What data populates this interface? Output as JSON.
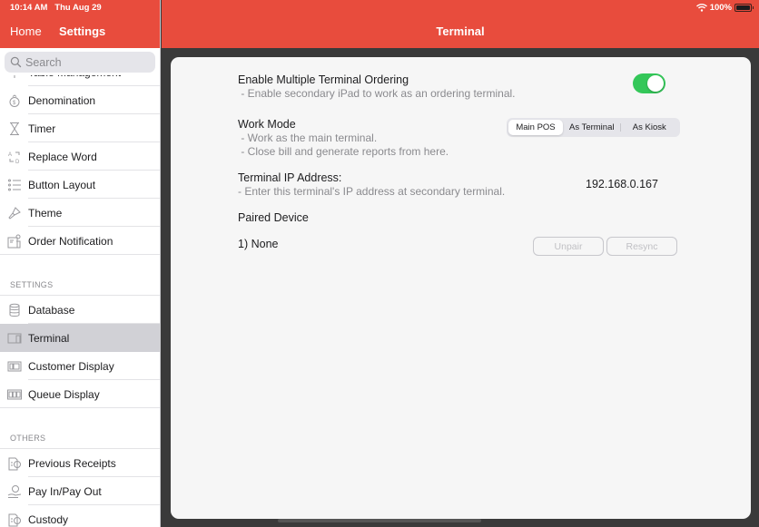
{
  "status_bar": {
    "time": "10:14 AM",
    "date": "Thu Aug 29",
    "battery_text": "100%",
    "wifi_icon": "wifi-icon",
    "battery_icon": "battery-icon"
  },
  "sidebar": {
    "nav": {
      "home_label": "Home",
      "title": "Settings"
    },
    "search": {
      "placeholder": "Search",
      "value": ""
    },
    "partial_item": {
      "label": "Table Management",
      "icon": "table-icon"
    },
    "groups": [
      {
        "header": "",
        "items": [
          {
            "label": "Denomination",
            "icon": "money-bag-icon"
          },
          {
            "label": "Timer",
            "icon": "hourglass-icon"
          },
          {
            "label": "Replace Word",
            "icon": "replace-icon"
          },
          {
            "label": "Button Layout",
            "icon": "list-icon"
          },
          {
            "label": "Theme",
            "icon": "brush-icon"
          },
          {
            "label": "Order Notification",
            "icon": "notification-icon"
          }
        ]
      },
      {
        "header": "SETTINGS",
        "items": [
          {
            "label": "Database",
            "icon": "database-icon"
          },
          {
            "label": "Terminal",
            "icon": "terminal-icon",
            "selected": true
          },
          {
            "label": "Customer Display",
            "icon": "customer-display-icon"
          },
          {
            "label": "Queue Display",
            "icon": "queue-display-icon"
          }
        ]
      },
      {
        "header": "OTHERS",
        "items": [
          {
            "label": "Previous Receipts",
            "icon": "receipt-icon"
          },
          {
            "label": "Pay In/Pay Out",
            "icon": "pay-hand-icon"
          },
          {
            "label": "Custody",
            "icon": "receipt-icon"
          }
        ]
      }
    ]
  },
  "main": {
    "title": "Terminal",
    "multi_terminal": {
      "title": "Enable Multiple Terminal Ordering",
      "desc": " - Enable secondary iPad to work as an ordering terminal.",
      "enabled": true
    },
    "work_mode": {
      "title": "Work Mode",
      "desc_lines": [
        " - Work as the main terminal.",
        " - Close bill and generate reports from here."
      ],
      "options": [
        "Main POS",
        "As Terminal",
        "As Kiosk"
      ],
      "selected": "Main POS"
    },
    "ip": {
      "title": "Terminal IP Address:",
      "desc": "- Enter this terminal's IP address at secondary terminal.",
      "value": "192.168.0.167"
    },
    "paired": {
      "title": "Paired Device",
      "entry": "1) None",
      "unpair_label": "Unpair",
      "resync_label": "Resync"
    }
  },
  "colors": {
    "brand": "#e84c3d",
    "toggle_on": "#34c759",
    "selected_row": "#d1d1d6"
  }
}
